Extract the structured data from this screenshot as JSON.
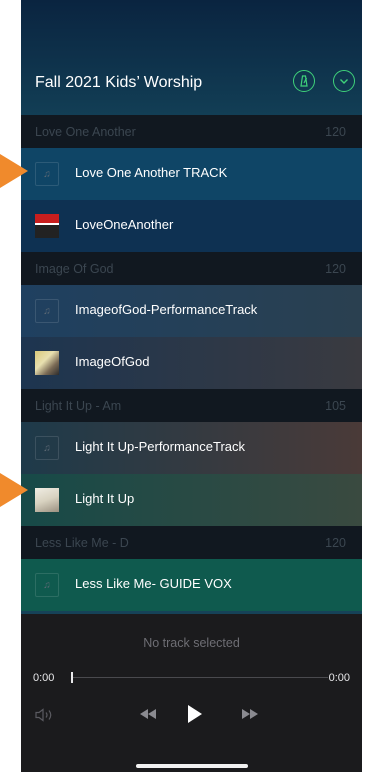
{
  "header": {
    "title": "Fall 2021 Kids’ Worship",
    "metronome_icon": "metronome-icon",
    "collapse_icon": "chevron-down-icon"
  },
  "sections": [
    {
      "name": "Love One Another",
      "bpm": "120",
      "tracks": [
        {
          "title": "Love One Another TRACK",
          "art": "music-note-icon"
        },
        {
          "title": "LoveOneAnother",
          "art": "album-art"
        }
      ]
    },
    {
      "name": "Image Of God",
      "bpm": "120",
      "tracks": [
        {
          "title": "ImageofGod-PerformanceTrack",
          "art": "music-note-icon"
        },
        {
          "title": "ImageOfGod",
          "art": "album-art"
        }
      ]
    },
    {
      "name": "Light It Up - Am",
      "bpm": "105",
      "tracks": [
        {
          "title": "Light It Up-PerformanceTrack",
          "art": "music-note-icon"
        },
        {
          "title": "Light It Up",
          "art": "album-art"
        }
      ]
    },
    {
      "name": "Less Like Me - D",
      "bpm": "120",
      "tracks": [
        {
          "title": "Less Like Me- GUIDE VOX",
          "art": "music-note-icon"
        }
      ]
    }
  ],
  "player": {
    "status": "No track selected",
    "elapsed": "0:00",
    "remaining": "0:00",
    "progress": 0
  },
  "colors": {
    "accent": "#3fd27a",
    "annotation": "#f08a2c"
  }
}
